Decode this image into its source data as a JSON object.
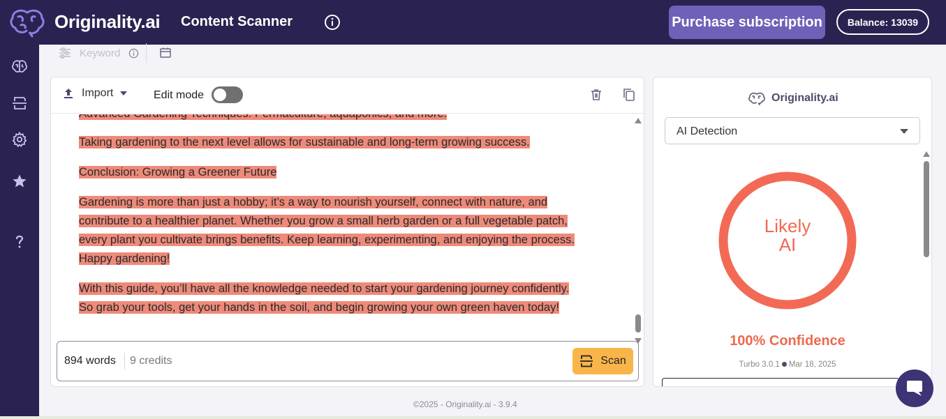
{
  "header": {
    "brand": "Originality.ai",
    "title": "Content Scanner",
    "purchase_label": "Purchase subscription",
    "balance_label": "Balance: 13039"
  },
  "sidebar": {
    "items": [
      {
        "icon": "brain-icon"
      },
      {
        "icon": "scan-icon"
      },
      {
        "icon": "gear-icon"
      },
      {
        "icon": "star-icon"
      },
      {
        "icon": "help-icon"
      }
    ]
  },
  "toolbar": {
    "keyword_label": "Keyword"
  },
  "editor": {
    "import_label": "Import",
    "edit_mode_label": "Edit mode",
    "edit_mode_on": false,
    "partial_heading": "Advanced Gardening Techniques: Permaculture, aquaponics, and more.",
    "paragraphs": [
      [
        "Taking gardening to the next level allows for sustainable and long-term growing success."
      ],
      [
        "Conclusion: Growing a Greener Future"
      ],
      [
        "Gardening is more than just a hobby; it’s a way to nourish yourself, connect with nature, and",
        "contribute to a healthier planet.  Whether you grow a small herb garden or a full vegetable patch,",
        "every plant you cultivate brings benefits.  Keep learning, experimenting, and enjoying the process.",
        "Happy gardening!"
      ],
      [
        "With this guide, you’ll have all the knowledge needed to start your gardening journey confidently.",
        "So grab your tools, get your hands in the soil, and begin growing your own green haven today!"
      ]
    ],
    "word_count": "894 words",
    "credits": "9 credits",
    "scan_label": "Scan"
  },
  "result": {
    "brand": "Originality.ai",
    "mode_selected": "AI Detection",
    "verdict_line1": "Likely",
    "verdict_line2": "AI",
    "confidence": "100% Confidence",
    "model": "Turbo 3.0.1",
    "date": "Mar 18, 2025",
    "accent_color": "#f06a52"
  },
  "footer": {
    "text": "©2025 - Originality.ai - 3.9.4"
  },
  "colors": {
    "nav_bg": "#2a2250",
    "purchase_bg": "#6f61b8",
    "highlight": "#ee8a7a",
    "scan_button": "#f9b54a"
  }
}
